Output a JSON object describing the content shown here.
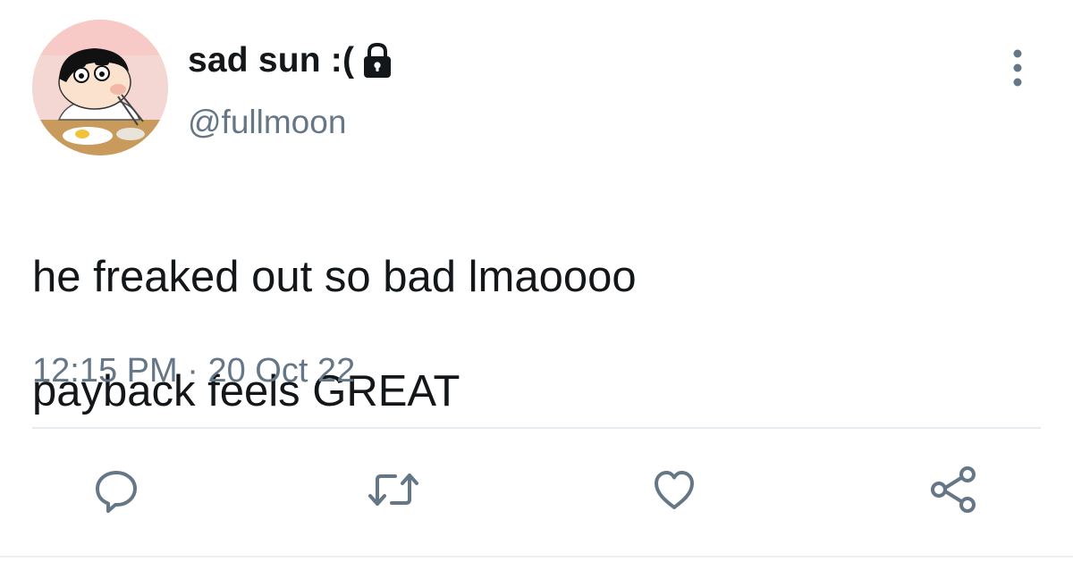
{
  "tweet": {
    "author": {
      "display_name": "sad sun :(",
      "handle": "@fullmoon",
      "avatar_icon": "cartoon-avatar",
      "protected_icon": "lock-icon"
    },
    "text_line_1": "he freaked out so bad lmaoooo",
    "text_line_2": "payback feels GREAT",
    "time": "12:15 PM",
    "separator": "·",
    "date": "20 Oct 22",
    "more_icon": "more-vertical-icon",
    "actions": [
      {
        "name": "reply",
        "icon": "reply-icon"
      },
      {
        "name": "retweet",
        "icon": "retweet-icon"
      },
      {
        "name": "like",
        "icon": "heart-icon"
      },
      {
        "name": "share",
        "icon": "share-icon"
      }
    ]
  },
  "colors": {
    "text_primary": "#14171a",
    "text_secondary": "#657786",
    "icon": "#657786",
    "divider": "#e6ecf0"
  }
}
